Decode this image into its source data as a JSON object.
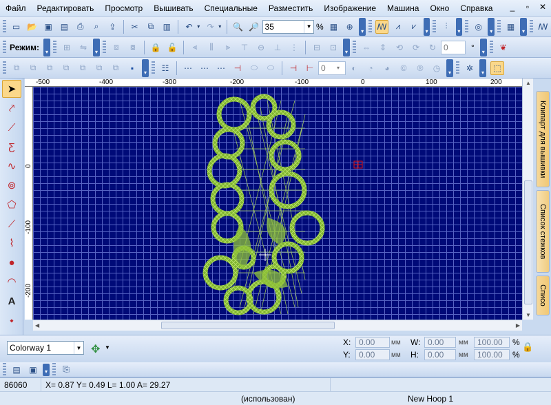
{
  "menu": [
    "Файл",
    "Редактировать",
    "Просмотр",
    "Вышивать",
    "Специальные",
    "Разместить",
    "Изображение",
    "Машина",
    "Окно",
    "Справка"
  ],
  "window_controls": [
    "_",
    "▫",
    "✕"
  ],
  "toolbar1": {
    "zoom_value": "35",
    "zoom_unit": "%"
  },
  "toolbar2": {
    "mode_label": "Режим:",
    "angle_value": "0",
    "angle_unit": "°"
  },
  "toolbar3": {
    "value": "0"
  },
  "rulers": {
    "top": [
      "-500",
      "-400",
      "-300",
      "-200",
      "-100",
      "0",
      "100",
      "200"
    ],
    "left": [
      "0",
      "-100",
      "-200"
    ]
  },
  "right_tabs": [
    "Клипарт для вышивки",
    "Список стежков",
    "Списо"
  ],
  "colorway": {
    "value": "Colorway 1"
  },
  "coords": {
    "x_label": "X:",
    "x_value": "0.00",
    "y_label": "Y:",
    "y_value": "0.00",
    "w_label": "W:",
    "w_value": "0.00",
    "h_label": "H:",
    "h_value": "0.00",
    "unit": "мм",
    "pct1": "100.00",
    "pct2": "100.00",
    "pct_unit": "%"
  },
  "status": {
    "stitch_count": "86060",
    "position": "X=  0.87 Y=   0.49 L=  1.00 A=  29.27"
  },
  "status2": {
    "used": "(использован)",
    "hoop": "New Hoop 1"
  },
  "colors": {
    "canvas": "#000a78",
    "grid": "#5664c4",
    "design": "#8fc23a"
  }
}
